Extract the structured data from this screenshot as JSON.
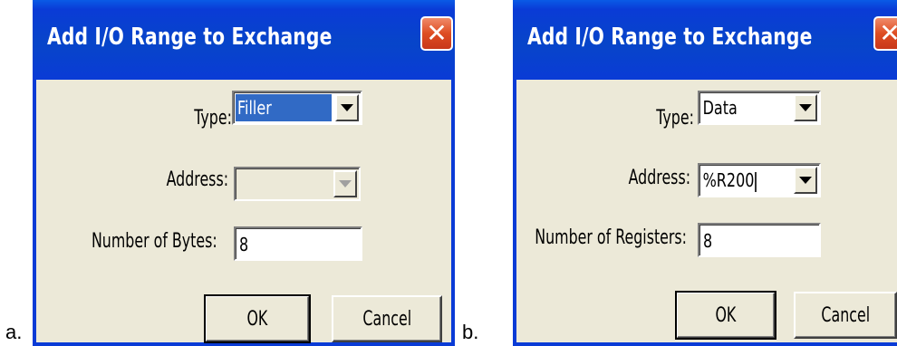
{
  "figure_labels": {
    "a": "a.",
    "b": "b."
  },
  "dialog_a": {
    "title": "Add I/O Range to Exchange",
    "type_label": "Type:",
    "type_value": "Filler",
    "address_label": "Address:",
    "address_value": "",
    "count_label": "Number of Bytes:",
    "count_value": "8",
    "ok_label": "OK",
    "cancel_label": "Cancel"
  },
  "dialog_b": {
    "title": "Add I/O Range to Exchange",
    "type_label": "Type:",
    "type_value": "Data",
    "address_label": "Address:",
    "address_value": "%R200",
    "count_label": "Number of Registers:",
    "count_value": "8",
    "ok_label": "OK",
    "cancel_label": "Cancel"
  },
  "icons": {
    "close": "close-icon",
    "dropdown": "chevron-down-icon"
  },
  "colors": {
    "titlebar": "#0a3bd6",
    "close_button": "#de4d22",
    "dialog_bg": "#ece9d8",
    "selection": "#316ac5"
  }
}
